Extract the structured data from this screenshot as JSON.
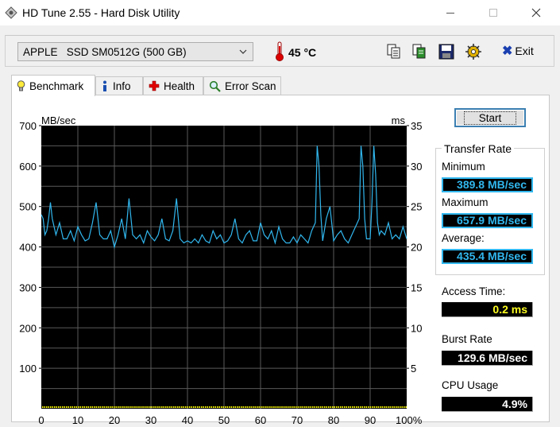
{
  "window": {
    "title": "HD Tune 2.55 - Hard Disk Utility"
  },
  "toolbar": {
    "drive": "APPLE   SSD SM0512G (500 GB)",
    "temperature": "45 °C",
    "exit_label": "Exit"
  },
  "tabs": [
    {
      "label": "Benchmark"
    },
    {
      "label": "Info"
    },
    {
      "label": "Health"
    },
    {
      "label": "Error Scan"
    }
  ],
  "benchmark": {
    "start_label": "Start",
    "transfer_rate_title": "Transfer Rate",
    "minimum_label": "Minimum",
    "minimum_value": "389.8 MB/sec",
    "maximum_label": "Maximum",
    "maximum_value": "657.9 MB/sec",
    "average_label": "Average:",
    "average_value": "435.4 MB/sec",
    "access_time_label": "Access Time:",
    "access_time_value": "0.2 ms",
    "burst_rate_label": "Burst Rate",
    "burst_rate_value": "129.6 MB/sec",
    "cpu_usage_label": "CPU Usage",
    "cpu_usage_value": "4.9%"
  },
  "colors": {
    "transfer_line": "#31b7ee",
    "access_dots": "#ffff00",
    "grid": "#5a5a5a",
    "plot_bg": "#000000"
  },
  "chart_data": {
    "type": "line",
    "y_left_unit": "MB/sec",
    "y_right_unit": "ms",
    "ylim_left": [
      0,
      700
    ],
    "ylim_right": [
      0,
      35
    ],
    "x_ticks": [
      "0",
      "10",
      "20",
      "30",
      "40",
      "50",
      "60",
      "70",
      "80",
      "90",
      "100%"
    ],
    "y_left_ticks": [
      "700",
      "600",
      "500",
      "400",
      "300",
      "200",
      "100"
    ],
    "y_right_ticks": [
      "35",
      "30",
      "25",
      "20",
      "15",
      "10",
      "5"
    ],
    "grid": true,
    "series": [
      {
        "x": [
          0,
          0.5,
          1,
          1.5,
          2,
          2.5,
          3,
          4,
          5,
          6,
          7,
          8,
          9,
          10,
          11,
          12,
          13,
          14,
          15,
          16,
          17,
          18,
          19,
          20,
          21,
          22,
          23,
          24,
          25,
          26,
          27,
          28,
          29,
          30,
          31,
          32,
          33,
          34,
          35,
          36,
          37,
          38,
          39,
          40,
          41,
          42,
          43,
          44,
          45,
          46,
          47,
          48,
          49,
          50,
          51,
          52,
          53,
          54,
          55,
          56,
          57,
          58,
          59,
          60,
          61,
          62,
          63,
          64,
          65,
          66,
          67,
          68,
          69,
          70,
          71,
          72,
          73,
          74,
          75,
          75.5,
          76,
          76.5,
          77,
          78,
          79,
          80,
          81,
          82,
          83,
          84,
          85,
          86,
          87,
          87.5,
          88,
          88.5,
          89,
          90,
          90.5,
          91,
          91.5,
          92,
          92.5,
          93,
          94,
          95,
          96,
          97,
          98,
          99,
          100
        ],
        "values": [
          480,
          470,
          430,
          440,
          470,
          510,
          470,
          430,
          460,
          420,
          420,
          440,
          415,
          450,
          430,
          415,
          420,
          460,
          510,
          430,
          420,
          420,
          440,
          400,
          430,
          470,
          420,
          520,
          430,
          420,
          430,
          410,
          440,
          425,
          415,
          430,
          470,
          420,
          415,
          440,
          520,
          420,
          410,
          415,
          410,
          420,
          410,
          430,
          415,
          410,
          440,
          420,
          430,
          410,
          415,
          430,
          470,
          420,
          410,
          430,
          440,
          415,
          415,
          460,
          430,
          420,
          440,
          410,
          450,
          420,
          410,
          410,
          425,
          410,
          430,
          420,
          410,
          440,
          460,
          650,
          600,
          480,
          415,
          470,
          500,
          415,
          430,
          440,
          420,
          410,
          430,
          450,
          470,
          650,
          600,
          470,
          420,
          420,
          510,
          650,
          580,
          460,
          430,
          440,
          430,
          460,
          420,
          430,
          420,
          450,
          420
        ]
      }
    ]
  }
}
